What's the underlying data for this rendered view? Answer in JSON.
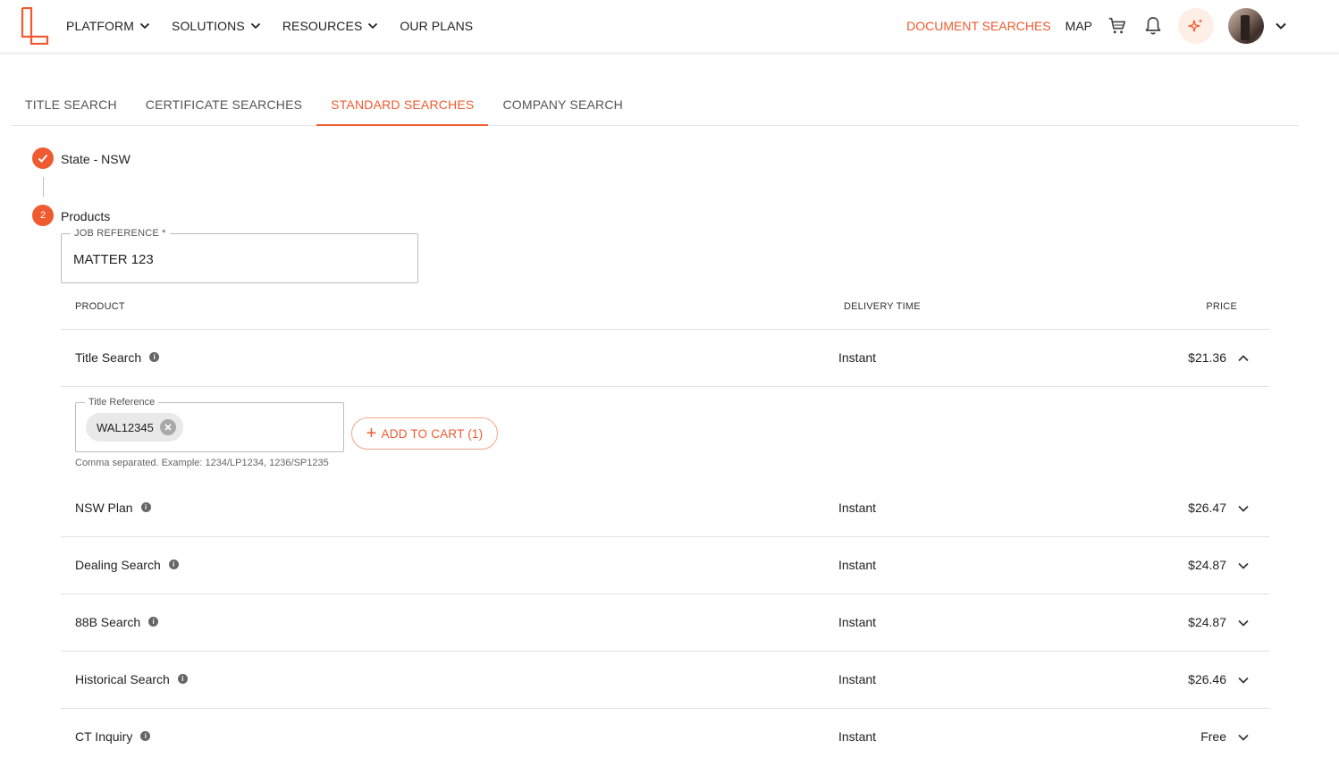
{
  "header": {
    "nav": [
      {
        "label": "PLATFORM",
        "dropdown": true
      },
      {
        "label": "SOLUTIONS",
        "dropdown": true
      },
      {
        "label": "RESOURCES",
        "dropdown": true
      },
      {
        "label": "OUR PLANS",
        "dropdown": false
      }
    ],
    "document_searches": "DOCUMENT SEARCHES",
    "map": "MAP",
    "icons": [
      "cart-icon",
      "bell-icon",
      "sparkle-icon",
      "avatar",
      "chevron-down-icon"
    ]
  },
  "tabs": [
    {
      "label": "TITLE SEARCH",
      "active": false
    },
    {
      "label": "CERTIFICATE SEARCHES",
      "active": false
    },
    {
      "label": "STANDARD SEARCHES",
      "active": true
    },
    {
      "label": "COMPANY SEARCH",
      "active": false
    }
  ],
  "stepper": {
    "step1": {
      "label": "State - NSW",
      "status": "done"
    },
    "step2": {
      "number": "2",
      "label": "Products",
      "status": "active"
    }
  },
  "job_reference": {
    "label": "JOB REFERENCE *",
    "value": "MATTER 123"
  },
  "table": {
    "headers": {
      "product": "PRODUCT",
      "delivery": "DELIVERY TIME",
      "price": "PRICE"
    },
    "expanded_row": {
      "name": "Title Search",
      "delivery": "Instant",
      "price": "$21.36",
      "title_reference_label": "Title Reference",
      "chip": "WAL12345",
      "helper": "Comma separated. Example: 1234/LP1234, 1236/SP1235",
      "add_to_cart": "ADD TO CART (1)"
    },
    "rows": [
      {
        "name": "NSW Plan",
        "delivery": "Instant",
        "price": "$26.47"
      },
      {
        "name": "Dealing Search",
        "delivery": "Instant",
        "price": "$24.87"
      },
      {
        "name": "88B Search",
        "delivery": "Instant",
        "price": "$24.87"
      },
      {
        "name": "Historical Search",
        "delivery": "Instant",
        "price": "$26.46"
      },
      {
        "name": "CT Inquiry",
        "delivery": "Instant",
        "price": "Free"
      }
    ]
  },
  "colors": {
    "accent": "#f05a30",
    "accent_light": "#fdeee6",
    "border": "#e0e0e0"
  }
}
